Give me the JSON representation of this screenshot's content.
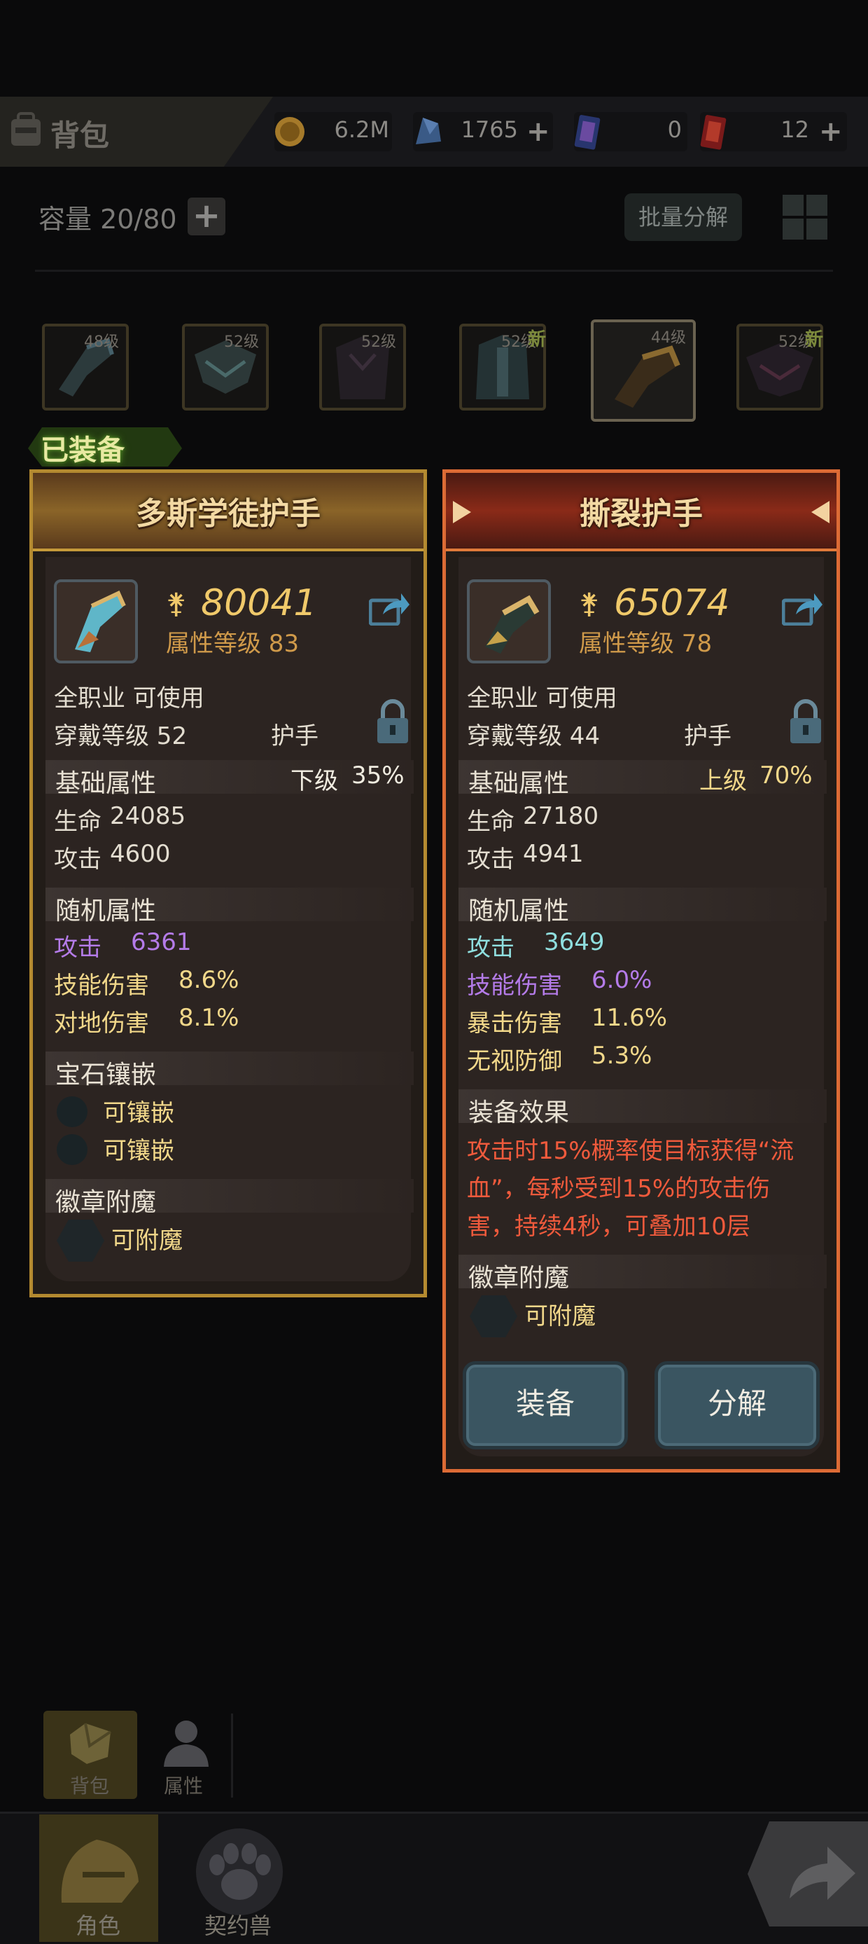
{
  "header": {
    "tab_title": "背包",
    "icons": {
      "tab": "backpack-icon",
      "gold": "gold-coin-icon",
      "crystal": "crystal-icon",
      "blue_ticket": "blue-ticket-icon",
      "red_ticket": "red-ticket-icon"
    },
    "resources": [
      {
        "name": "gold",
        "value": "6.2M"
      },
      {
        "name": "crystal",
        "value": "1765"
      },
      {
        "name": "blue_ticket",
        "value": "0"
      },
      {
        "name": "red_ticket",
        "value": "12"
      }
    ]
  },
  "inventory": {
    "capacity": "容量 20/80",
    "batch_button": "批量分解",
    "slots": [
      {
        "level": "48级",
        "new": ""
      },
      {
        "level": "52级",
        "new": ""
      },
      {
        "level": "52级",
        "new": ""
      },
      {
        "level": "52级",
        "new": "新"
      },
      {
        "level": "44级",
        "new": ""
      },
      {
        "level": "52级",
        "new": "新"
      }
    ]
  },
  "equipped_badge": "已装备",
  "left_card": {
    "title": "多斯学徒护手",
    "power": "80041",
    "attr_level": "属性等级 83",
    "class_line": "全职业 可使用",
    "wear_level": "穿戴等级 52",
    "slot_type": "护手",
    "base_header": "基础属性",
    "grade": "下级",
    "grade_pct": "35%",
    "base_stats": [
      {
        "name": "生命",
        "value": "24085"
      },
      {
        "name": "攻击",
        "value": "4600"
      }
    ],
    "random_header": "随机属性",
    "random_stats": [
      {
        "name": "攻击",
        "value": "6361",
        "color": "#b47be8"
      },
      {
        "name": "技能伤害",
        "value": "8.6%",
        "color": "#f2d88a"
      },
      {
        "name": "对地伤害",
        "value": "8.1%",
        "color": "#f2d88a"
      }
    ],
    "gem_header": "宝石镶嵌",
    "gem_slots": [
      "可镶嵌",
      "可镶嵌"
    ],
    "badge_header": "徽章附魔",
    "badge_slot": "可附魔"
  },
  "right_card": {
    "title": "撕裂护手",
    "power": "65074",
    "attr_level": "属性等级 78",
    "class_line": "全职业 可使用",
    "wear_level": "穿戴等级 44",
    "slot_type": "护手",
    "base_header": "基础属性",
    "grade": "上级",
    "grade_pct": "70%",
    "base_stats": [
      {
        "name": "生命",
        "value": "27180"
      },
      {
        "name": "攻击",
        "value": "4941"
      }
    ],
    "random_header": "随机属性",
    "random_stats": [
      {
        "name": "攻击",
        "value": "3649",
        "color": "#8fdede"
      },
      {
        "name": "技能伤害",
        "value": "6.0%",
        "color": "#b47be8"
      },
      {
        "name": "暴击伤害",
        "value": "11.6%",
        "color": "#f2d88a"
      },
      {
        "name": "无视防御",
        "value": "5.3%",
        "color": "#f2d88a"
      }
    ],
    "effect_header": "装备效果",
    "effect_lines": [
      "攻击时15%概率使目标获得“流",
      "血”，每秒受到15%的攻击伤",
      "害，持续4秒，可叠加10层"
    ],
    "badge_header": "徽章附魔",
    "badge_slot": "可附魔",
    "equip_button": "装备",
    "decompose_button": "分解"
  },
  "bottom_nav": {
    "sub_tabs": [
      "背包",
      "属性"
    ],
    "main_tabs": [
      "角色",
      "契约兽"
    ]
  },
  "colors": {
    "left_border": "#b48a30",
    "right_border": "#dc6b35",
    "power": "#f0c96a",
    "effect_text": "#ef5a3c"
  }
}
